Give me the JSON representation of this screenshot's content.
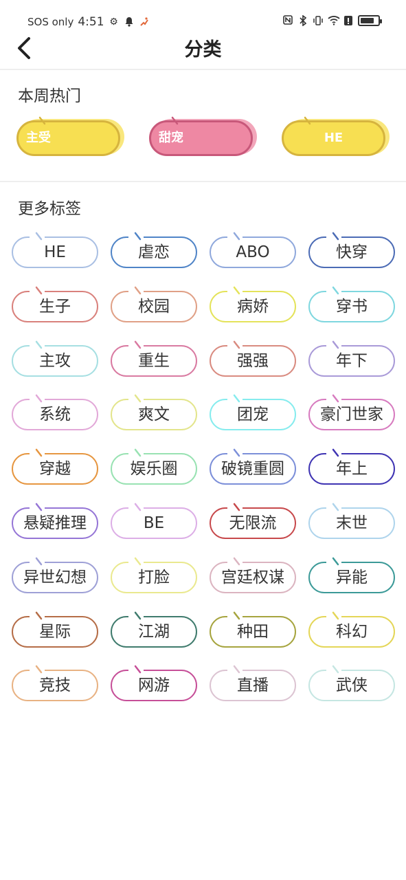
{
  "status": {
    "network": "SOS only",
    "time": "4:51",
    "battery_level": 0.8
  },
  "nav": {
    "title": "分类"
  },
  "hot": {
    "title": "本周热门",
    "tags": [
      {
        "label": "主受",
        "color": "#f7df52",
        "border": "#d6b43e"
      },
      {
        "label": "甜宠",
        "color": "#ee88a3",
        "border": "#c8587a"
      },
      {
        "label": "HE",
        "color": "#f7df52",
        "border": "#d6b43e"
      }
    ]
  },
  "more": {
    "title": "更多标签",
    "tags": [
      {
        "label": "HE",
        "color": "#a9bfe3"
      },
      {
        "label": "虐恋",
        "color": "#4f84c7"
      },
      {
        "label": "ABO",
        "color": "#8fa8dc"
      },
      {
        "label": "快穿",
        "color": "#4b6bb5"
      },
      {
        "label": "生子",
        "color": "#d9817c"
      },
      {
        "label": "校园",
        "color": "#e0a086"
      },
      {
        "label": "病娇",
        "color": "#e4e35a"
      },
      {
        "label": "穿书",
        "color": "#7fd7df"
      },
      {
        "label": "主攻",
        "color": "#a6dfe2"
      },
      {
        "label": "重生",
        "color": "#d97aa1"
      },
      {
        "label": "强强",
        "color": "#d98b80"
      },
      {
        "label": "年下",
        "color": "#a99ad8"
      },
      {
        "label": "系统",
        "color": "#e2a8d8"
      },
      {
        "label": "爽文",
        "color": "#e3e58c"
      },
      {
        "label": "团宠",
        "color": "#86ecee"
      },
      {
        "label": "豪门世家",
        "color": "#d77bbf"
      },
      {
        "label": "穿越",
        "color": "#e69640"
      },
      {
        "label": "娱乐圈",
        "color": "#98e2b2"
      },
      {
        "label": "破镜重圆",
        "color": "#7c8fd9"
      },
      {
        "label": "年上",
        "color": "#3f34b3"
      },
      {
        "label": "悬疑推理",
        "color": "#9575d6"
      },
      {
        "label": "BE",
        "color": "#dcaee6"
      },
      {
        "label": "无限流",
        "color": "#c7484b"
      },
      {
        "label": "末世",
        "color": "#aed4ec"
      },
      {
        "label": "异世幻想",
        "color": "#9ea0d6"
      },
      {
        "label": "打脸",
        "color": "#eae98f"
      },
      {
        "label": "宫廷权谋",
        "color": "#dbb4c0"
      },
      {
        "label": "异能",
        "color": "#3c9a98"
      },
      {
        "label": "星际",
        "color": "#b56d47"
      },
      {
        "label": "江湖",
        "color": "#3f7b6d"
      },
      {
        "label": "种田",
        "color": "#a6a43e"
      },
      {
        "label": "科幻",
        "color": "#e4d657"
      },
      {
        "label": "竞技",
        "color": "#e8b283"
      },
      {
        "label": "网游",
        "color": "#c64f98"
      },
      {
        "label": "直播",
        "color": "#dcc4d2"
      },
      {
        "label": "武侠",
        "color": "#c5e6e2"
      }
    ]
  }
}
